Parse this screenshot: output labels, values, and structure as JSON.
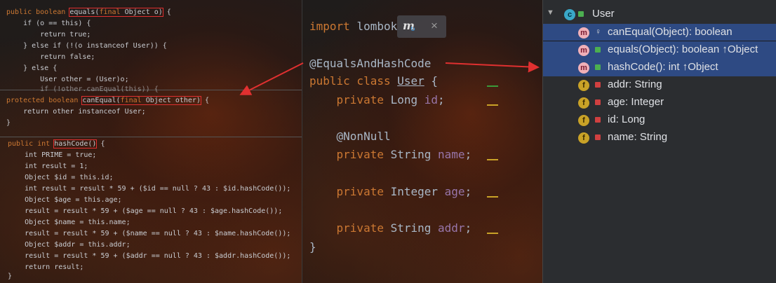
{
  "left_code": {
    "equals_lines": [
      "public boolean equals(final Object o) {",
      "    if (o == this) {",
      "        return true;",
      "    } else if (!(o instanceof User)) {",
      "        return false;",
      "    } else {",
      "        User other = (User)o;",
      "        if (!other.canEqual(this)) {"
    ],
    "canequal_lines": [
      "protected boolean canEqual(final Object other) {",
      "    return other instanceof User;",
      "}"
    ],
    "hashcode_lines": [
      "public int hashCode() {",
      "    int PRIME = true;",
      "    int result = 1;",
      "    Object $id = this.id;",
      "    int result = result * 59 + ($id == null ? 43 : $id.hashCode());",
      "    Object $age = this.age;",
      "    result = result * 59 + ($age == null ? 43 : $age.hashCode());",
      "    Object $name = this.name;",
      "    result = result * 59 + ($name == null ? 43 : $name.hashCode());",
      "    Object $addr = this.addr;",
      "    result = result * 59 + ($addr == null ? 43 : $addr.hashCode());",
      "    return result;",
      "}"
    ]
  },
  "mid_code": {
    "import_line": "import lombok",
    "popup_close": "×",
    "annotation": "@EqualsAndHashCode",
    "class_decl": "public class User {",
    "field_id": "    private Long id;",
    "nonnull": "    @NonNull",
    "field_name": "    private String name;",
    "field_age": "    private Integer age;",
    "field_addr": "    private String addr;",
    "close_brace": "}"
  },
  "structure": {
    "root": "User",
    "items": [
      {
        "badge": "m",
        "label": "canEqual(Object): boolean",
        "selected": true
      },
      {
        "badge": "m",
        "label": "equals(Object): boolean ↑Object",
        "selected": true
      },
      {
        "badge": "m",
        "label": "hashCode(): int ↑Object",
        "selected": true
      },
      {
        "badge": "f",
        "label": "addr: String",
        "selected": false
      },
      {
        "badge": "f",
        "label": "age: Integer",
        "selected": false
      },
      {
        "badge": "f",
        "label": "id: Long",
        "selected": false
      },
      {
        "badge": "f",
        "label": "name: String",
        "selected": false
      }
    ]
  },
  "colors": {
    "selection": "#2e4a83",
    "arrow": "#e03030",
    "highlight_box": "#e03030"
  }
}
